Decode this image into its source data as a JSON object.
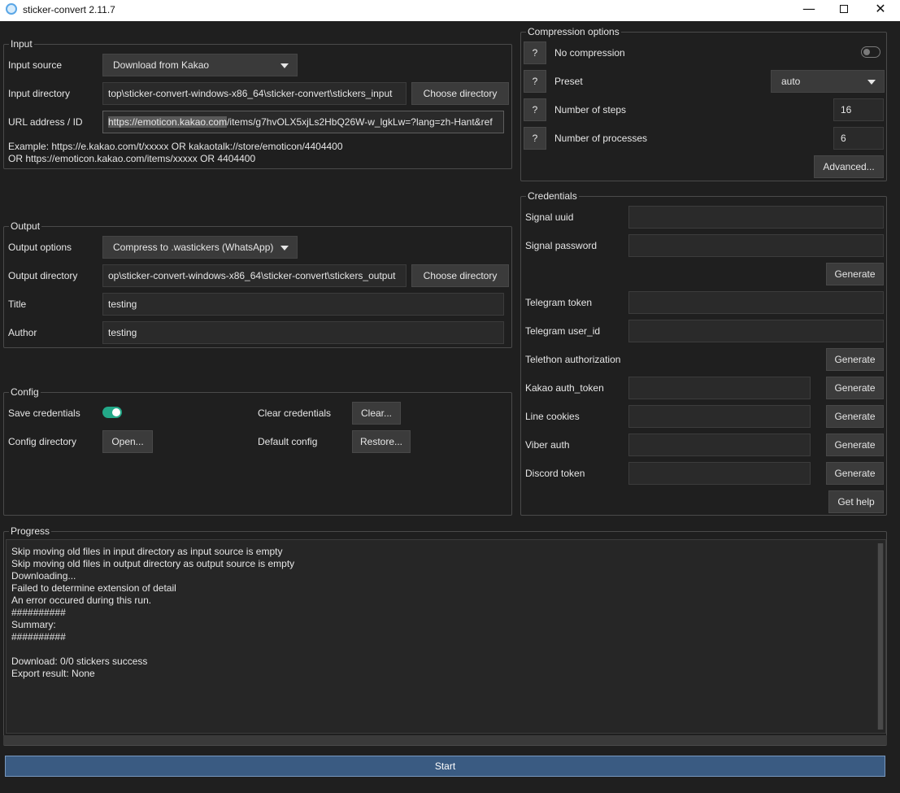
{
  "window": {
    "title": "sticker-convert 2.11.7",
    "min_glyph": "—",
    "close_glyph": "✕"
  },
  "input": {
    "legend": "Input",
    "source_label": "Input source",
    "source_value": "Download from Kakao",
    "dir_label": "Input directory",
    "dir_value": "top\\sticker-convert-windows-x86_64\\sticker-convert\\stickers_input",
    "choose_label": "Choose directory",
    "url_label": "URL address / ID",
    "url_highlight": "https://emoticon.kakao.com",
    "url_rest": "/items/g7hvOLX5xjLs2HbQ26W-w_lgkLw=?lang=zh-Hant&ref",
    "hint_line1": "Example: https://e.kakao.com/t/xxxxx OR kakaotalk://store/emoticon/4404400",
    "hint_line2": "OR https://emoticon.kakao.com/items/xxxxx OR 4404400"
  },
  "output": {
    "legend": "Output",
    "options_label": "Output options",
    "options_value": "Compress to .wastickers (WhatsApp)",
    "dir_label": "Output directory",
    "dir_value": "op\\sticker-convert-windows-x86_64\\sticker-convert\\stickers_output",
    "choose_label": "Choose directory",
    "title_label": "Title",
    "title_value": "testing",
    "author_label": "Author",
    "author_value": "testing"
  },
  "config": {
    "legend": "Config",
    "save_label": "Save credentials",
    "save_enabled": true,
    "clear_label": "Clear credentials",
    "clear_button": "Clear...",
    "dir_label": "Config directory",
    "open_button": "Open...",
    "default_label": "Default config",
    "restore_button": "Restore..."
  },
  "compression": {
    "legend": "Compression options",
    "help_glyph": "?",
    "no_comp_label": "No compression",
    "no_comp_enabled": false,
    "preset_label": "Preset",
    "preset_value": "auto",
    "steps_label": "Number of steps",
    "steps_value": "16",
    "processes_label": "Number of processes",
    "processes_value": "6",
    "advanced_button": "Advanced..."
  },
  "credentials": {
    "legend": "Credentials",
    "signal_uuid_label": "Signal uuid",
    "signal_password_label": "Signal password",
    "generate_label": "Generate",
    "telegram_token_label": "Telegram token",
    "telegram_userid_label": "Telegram user_id",
    "telethon_label": "Telethon authorization",
    "kakao_label": "Kakao auth_token",
    "line_label": "Line cookies",
    "viber_label": "Viber auth",
    "discord_label": "Discord token",
    "help_button": "Get help"
  },
  "progress": {
    "legend": "Progress",
    "log": [
      "Skip moving old files in input directory as input source is empty",
      "Skip moving old files in output directory as output source is empty",
      "Downloading...",
      "Failed to determine extension of detail",
      "An error occured during this run.",
      "##########",
      "Summary:",
      "##########",
      "",
      "Download: 0/0 stickers success",
      "Export result: None"
    ],
    "percent": 0
  },
  "start_button": "Start",
  "colors": {
    "accent": "#23a888",
    "start_bg": "#3a5b82",
    "bg": "#1f1f1f"
  }
}
